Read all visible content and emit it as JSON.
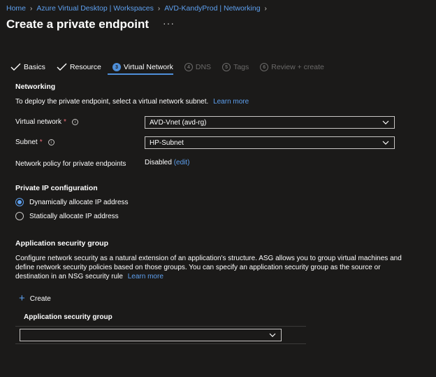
{
  "breadcrumb": [
    {
      "label": "Home"
    },
    {
      "label": "Azure Virtual Desktop | Workspaces"
    },
    {
      "label": "AVD-KandyProd | Networking"
    }
  ],
  "page_title": "Create a private endpoint",
  "more_label": "···",
  "tabs": [
    {
      "label": "Basics",
      "state": "done"
    },
    {
      "label": "Resource",
      "state": "done"
    },
    {
      "label": "Virtual Network",
      "state": "active",
      "step": "3"
    },
    {
      "label": "DNS",
      "state": "disabled",
      "step": "4"
    },
    {
      "label": "Tags",
      "state": "disabled",
      "step": "5"
    },
    {
      "label": "Review + create",
      "state": "disabled",
      "step": "6"
    }
  ],
  "networking": {
    "title": "Networking",
    "description": "To deploy the private endpoint, select a virtual network subnet.",
    "learn_more": "Learn more",
    "virtual_network_label": "Virtual network",
    "virtual_network_value": "AVD-Vnet (avd-rg)",
    "subnet_label": "Subnet",
    "subnet_value": "HP-Subnet",
    "required_mark": "*",
    "info_glyph": "i",
    "policy_label": "Network policy for private endpoints",
    "policy_value": "Disabled",
    "policy_edit": "(edit)"
  },
  "private_ip": {
    "title": "Private IP configuration",
    "options": [
      {
        "label": "Dynamically allocate IP address",
        "checked": true
      },
      {
        "label": "Statically allocate IP address",
        "checked": false
      }
    ]
  },
  "asg": {
    "title": "Application security group",
    "description_line1": "Configure network security as a natural extension of an application's structure. ASG allows you to group virtual machines and",
    "description_line2": "define network security policies based on those groups. You can specify an application security group as the source or",
    "description_line3": "destination in an NSG security rule",
    "learn_more": "Learn more",
    "create_label": "Create",
    "column_header": "Application security group",
    "select_value": ""
  },
  "colors": {
    "background": "#1b1a19",
    "link": "#5ea0ef",
    "accent": "#4f8fd9",
    "required": "#f1707b"
  }
}
